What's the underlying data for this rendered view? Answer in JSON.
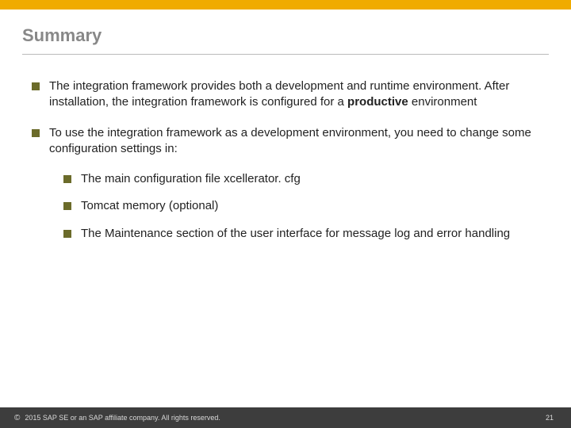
{
  "title": "Summary",
  "bullets": {
    "b1_pre": "The integration framework provides both a development and runtime environment. After installation, the integration framework is configured for a ",
    "b1_bold": "productive",
    "b1_post": " environment",
    "b2": "To  use the integration framework as a development environment, you need to change some configuration settings in:",
    "s1": "The main configuration file xcellerator. cfg",
    "s2": "Tomcat memory (optional)",
    "s3": "The Maintenance section of the user interface for message log and error handling"
  },
  "footer": {
    "copyright_symbol": "©",
    "copyright_text": "2015 SAP SE or an SAP affiliate company. All rights reserved.",
    "page_number": "21"
  }
}
